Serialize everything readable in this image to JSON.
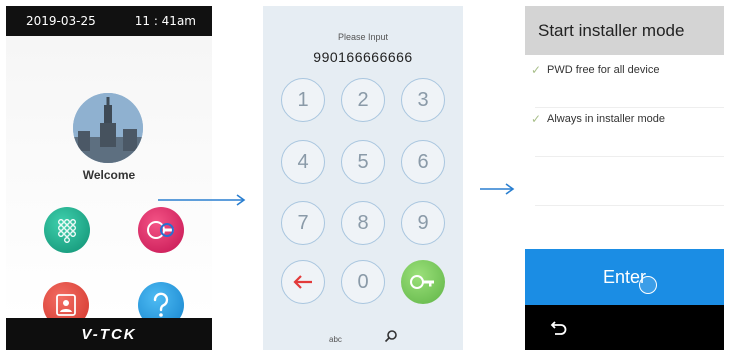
{
  "screen1": {
    "date": "2019-03-25",
    "time": "11 : 41am",
    "welcome": "Welcome",
    "brand": "V-TCK",
    "buttons": [
      "keypad-icon",
      "key-icon",
      "address-book-icon",
      "help-icon"
    ]
  },
  "screen2": {
    "prompt": "Please Input",
    "number": "990166666666",
    "keys": [
      "1",
      "2",
      "3",
      "4",
      "5",
      "6",
      "7",
      "8",
      "9",
      "0"
    ],
    "abc": "abc"
  },
  "screen3": {
    "title": "Start installer mode",
    "options": [
      "PWD free for all device",
      "Always in installer mode"
    ],
    "enter": "Enter"
  },
  "colors": {
    "accent_blue": "#1b8de4",
    "arrow": "#2a7fd0",
    "green_key": "#5fb446",
    "red_back": "#e23a3a"
  }
}
